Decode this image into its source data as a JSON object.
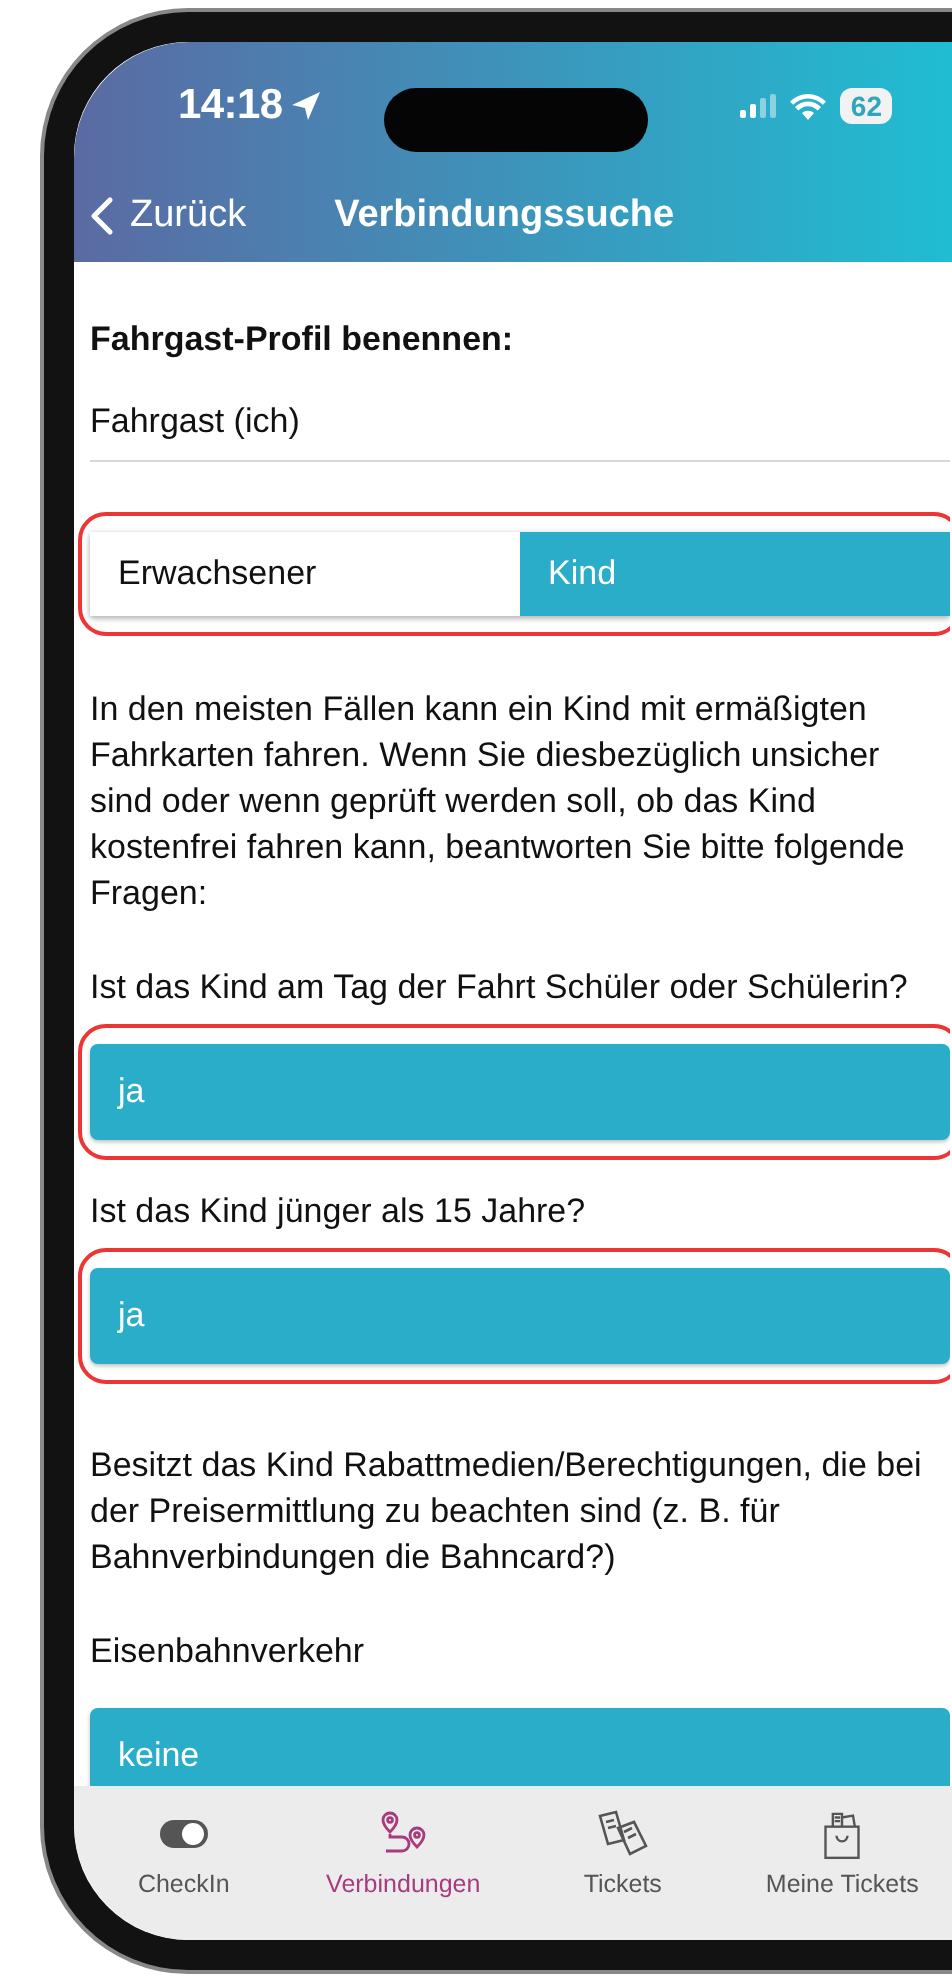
{
  "status_bar": {
    "time": "14:18",
    "battery": "62"
  },
  "header": {
    "back_label": "Zurück",
    "title": "Verbindungssuche"
  },
  "profile": {
    "label": "Fahrgast-Profil benennen:",
    "value": "Fahrgast (ich)"
  },
  "passenger_type": {
    "highlighted": true,
    "options": [
      {
        "label": "Erwachsener",
        "selected": false
      },
      {
        "label": "Kind",
        "selected": true
      }
    ]
  },
  "intro_text": "In den meisten Fällen kann ein Kind mit ermäßigten Fahrkarten fahren. Wenn Sie diesbezüglich unsicher sind oder wenn geprüft werden soll, ob das Kind kostenfrei fahren kann, beantworten Sie bitte folgende Fragen:",
  "questions": [
    {
      "question": "Ist das Kind am Tag der Fahrt Schüler oder Schülerin?",
      "answer": "ja",
      "highlighted": true
    },
    {
      "question": "Ist das Kind jünger als 15 Jahre?",
      "answer": "ja",
      "highlighted": true
    }
  ],
  "discount_text": "Besitzt das Kind Rabattmedien/Berechtigungen, die bei der Preisermittlung zu beachten sind (z. B. für Bahnverbindungen die Bahncard?)",
  "discounts": [
    {
      "label": "Eisenbahnverkehr",
      "value": "keine"
    }
  ],
  "tab_bar": [
    {
      "label": "CheckIn",
      "kind": "toggle",
      "selected": false
    },
    {
      "label": "Verbindungen",
      "kind": "route",
      "selected": true
    },
    {
      "label": "Tickets",
      "kind": "tickets",
      "selected": false
    },
    {
      "label": "Meine Tickets",
      "kind": "bag",
      "selected": false
    }
  ]
}
